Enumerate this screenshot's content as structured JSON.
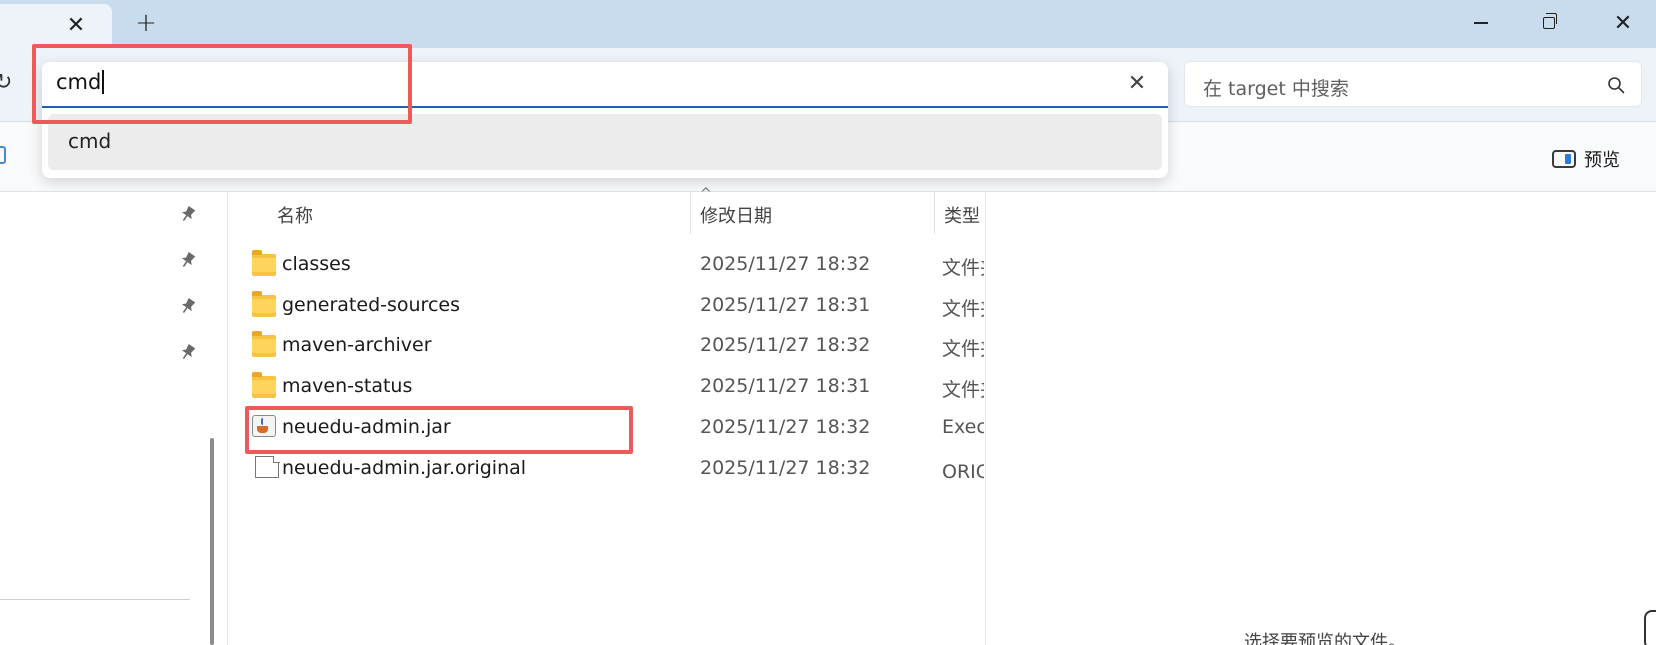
{
  "titlebar": {
    "new_tab_glyph": "+",
    "tab_close_glyph": "✕",
    "close_glyph": "✕"
  },
  "address": {
    "value": "cmd",
    "clear_glyph": "✕",
    "suggestions": [
      "cmd"
    ]
  },
  "search": {
    "placeholder": "在 target 中搜索"
  },
  "toolbar": {
    "preview_label": "预览"
  },
  "columns": {
    "name": "名称",
    "date": "修改日期",
    "type": "类型"
  },
  "files": [
    {
      "name": "classes",
      "date": "2025/11/27 18:32",
      "type": "文件夹",
      "icon": "folder-icon"
    },
    {
      "name": "generated-sources",
      "date": "2025/11/27 18:31",
      "type": "文件夹",
      "icon": "folder-icon"
    },
    {
      "name": "maven-archiver",
      "date": "2025/11/27 18:32",
      "type": "文件夹",
      "icon": "folder-icon"
    },
    {
      "name": "maven-status",
      "date": "2025/11/27 18:31",
      "type": "文件夹",
      "icon": "folder-icon"
    },
    {
      "name": "neuedu-admin.jar",
      "date": "2025/11/27 18:32",
      "type": "Executable Jar File",
      "icon": "java-jar-icon"
    },
    {
      "name": "neuedu-admin.jar.original",
      "date": "2025/11/27 18:32",
      "type": "ORIGINAL 文件",
      "icon": "file-icon"
    }
  ],
  "preview_pane": {
    "hint": "选择要预览的文件。"
  },
  "colors": {
    "titlebar": "#c9dcee",
    "address_row": "#eef3f9",
    "highlight": "#ee5a5a",
    "accent": "#1f5fae",
    "folder": "#ffd55c"
  }
}
